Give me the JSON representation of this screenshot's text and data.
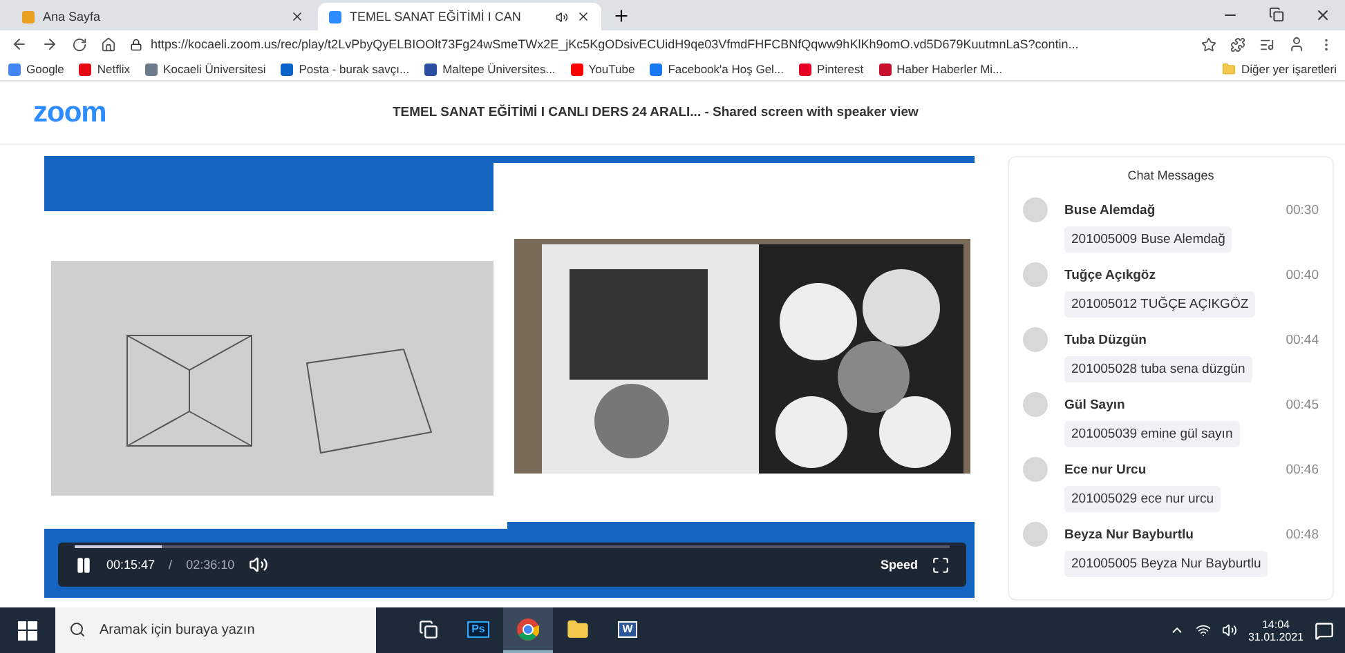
{
  "browser": {
    "tabs": [
      {
        "title": "Ana Sayfa",
        "selected": false,
        "audio": false
      },
      {
        "title": "TEMEL SANAT EĞİTİMİ I CAN",
        "selected": true,
        "audio": true
      }
    ],
    "url": "https://kocaeli.zoom.us/rec/play/t2LvPbyQyELBIOOlt73Fg24wSmeTWx2E_jKc5KgODsivECUidH9qe03VfmdFHFCBNfQqww9hKlKh9omO.vd5D679KuutmnLaS?contin...",
    "bookmarks": [
      {
        "label": "Google",
        "color": "#4285f4"
      },
      {
        "label": "Netflix",
        "color": "#e50914"
      },
      {
        "label": "Kocaeli Üniversitesi",
        "color": "#6b7b8c"
      },
      {
        "label": "Posta - burak savçı...",
        "color": "#0a64c8"
      },
      {
        "label": "Maltepe Üniversites...",
        "color": "#2a4ea0"
      },
      {
        "label": "YouTube",
        "color": "#ff0000"
      },
      {
        "label": "Facebook'a Hoş Gel...",
        "color": "#1877f2"
      },
      {
        "label": "Pinterest",
        "color": "#e60023"
      },
      {
        "label": "Haber Haberler Mi...",
        "color": "#c8102e"
      }
    ],
    "other_bookmarks": "Diğer yer işaretleri"
  },
  "zoom": {
    "logo": "zoom",
    "title": "TEMEL SANAT EĞİTİMİ I CANLI DERS 24 ARALI... - Shared screen with speaker view"
  },
  "player": {
    "current": "00:15:47",
    "separator": "/",
    "duration": "02:36:10",
    "speed": "Speed",
    "playing": true,
    "level": 0.1
  },
  "chat": {
    "title": "Chat Messages",
    "messages": [
      {
        "name": "Buse Alemdağ",
        "time": "00:30",
        "text": "201005009 Buse Alemdağ"
      },
      {
        "name": "Tuğçe Açıkgöz",
        "time": "00:40",
        "text": "201005012 TUĞÇE AÇIKGÖZ"
      },
      {
        "name": "Tuba Düzgün",
        "time": "00:44",
        "text": "201005028 tuba sena düzgün"
      },
      {
        "name": "Gül Sayın",
        "time": "00:45",
        "text": "201005039 emine gül sayın"
      },
      {
        "name": "Ece nur Urcu",
        "time": "00:46",
        "text": "201005029 ece nur urcu"
      },
      {
        "name": "Beyza Nur Bayburtlu",
        "time": "00:48",
        "text": "201005005 Beyza Nur Bayburtlu"
      }
    ]
  },
  "taskbar": {
    "search_placeholder": "Aramak için buraya yazın",
    "apps": [
      {
        "kind": "taskview"
      },
      {
        "kind": "photoshop",
        "label": "Ps"
      },
      {
        "kind": "chrome"
      },
      {
        "kind": "explorer"
      },
      {
        "kind": "word",
        "label": "W"
      }
    ],
    "time": "14:04",
    "date": "31.01.2021"
  }
}
